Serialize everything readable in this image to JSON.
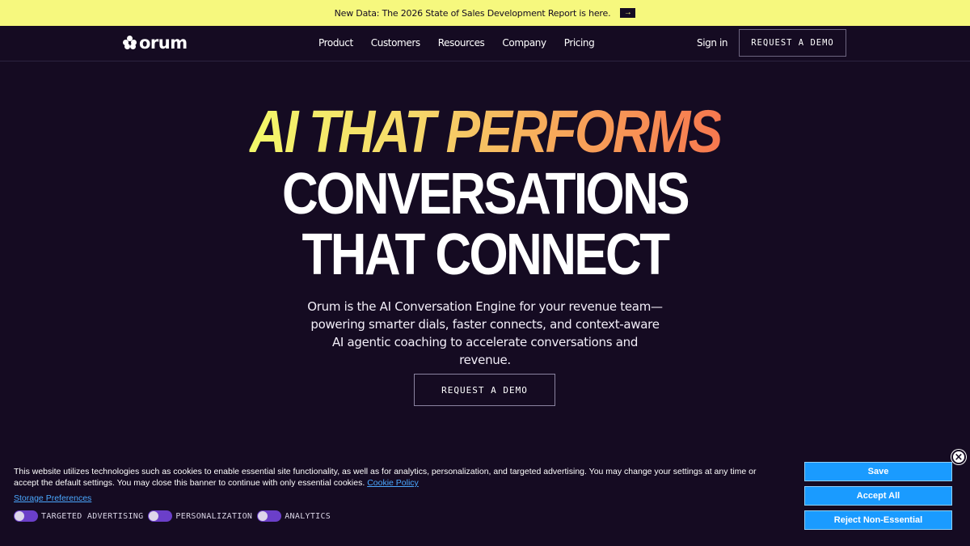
{
  "announcement": {
    "text": "New Data: The 2026 State of Sales Development Report is here.",
    "arrow_icon": "arrow-right-icon",
    "arrow_glyph": "→"
  },
  "nav": {
    "logo_text": "orum",
    "links": [
      "Product",
      "Customers",
      "Resources",
      "Company",
      "Pricing"
    ],
    "signin_label": "Sign in",
    "demo_label": "REQUEST A DEMO"
  },
  "hero": {
    "headline_1": "AI THAT PERFORMS",
    "headline_2": "CONVERSATIONS",
    "headline_3": "THAT CONNECT",
    "subtitle": "Orum is the AI Conversation Engine for your revenue team—powering smarter dials, faster connects, and context-aware AI agentic coaching to accelerate conversations and revenue.",
    "cta_label": "REQUEST A DEMO",
    "gradient_colors": [
      "#f3f86a",
      "#f7784f"
    ]
  },
  "cookie_banner": {
    "text": "This website utilizes technologies such as cookies to enable essential site functionality, as well as for analytics, personalization, and targeted advertising. You may change your settings at any time or accept the default settings. You may close this banner to continue with only essential cookies.",
    "policy_link": "Cookie Policy",
    "storage_link": "Storage Preferences",
    "toggles": [
      "TARGETED ADVERTISING",
      "PERSONALIZATION",
      "ANALYTICS"
    ],
    "save_label": "Save",
    "accept_label": "Accept All",
    "reject_label": "Reject Non-Essential",
    "close_glyph": "×",
    "button_color": "#1a9bff"
  },
  "colors": {
    "background": "#150b22",
    "announcement_bg": "#f6f87e",
    "toggle_on": "#6b3fc9"
  }
}
